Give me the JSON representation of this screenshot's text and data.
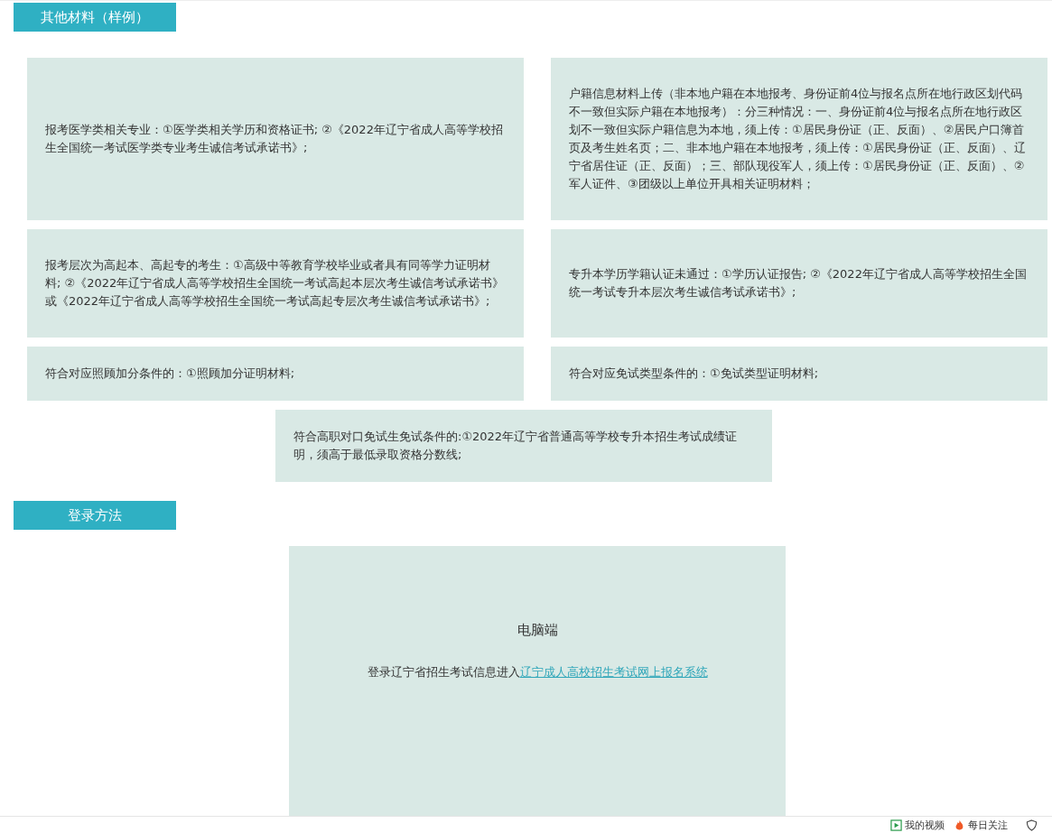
{
  "materials_section": {
    "title": "其他材料（样例）",
    "cards": [
      {
        "kind": "half",
        "text": "报考医学类相关专业：①医学类相关学历和资格证书; ②《2022年辽宁省成人高等学校招生全国统一考试医学类专业考生诚信考试承诺书》;"
      },
      {
        "kind": "half",
        "text": "户籍信息材料上传（非本地户籍在本地报考、身份证前4位与报名点所在地行政区划代码不一致但实际户籍在本地报考）：分三种情况：一、身份证前4位与报名点所在地行政区划不一致但实际户籍信息为本地，须上传：①居民身份证（正、反面）、②居民户口簿首页及考生姓名页；二、非本地户籍在本地报考，须上传：①居民身份证（正、反面）、辽宁省居住证（正、反面）；三、部队现役军人，须上传：①居民身份证（正、反面）、②军人证件、③团级以上单位开具相关证明材料；"
      },
      {
        "kind": "half",
        "text": "报考层次为高起本、高起专的考生：①高级中等教育学校毕业或者具有同等学力证明材料; ②《2022年辽宁省成人高等学校招生全国统一考试高起本层次考生诚信考试承诺书》或《2022年辽宁省成人高等学校招生全国统一考试高起专层次考生诚信考试承诺书》;"
      },
      {
        "kind": "half",
        "text": "专升本学历学籍认证未通过：①学历认证报告; ②《2022年辽宁省成人高等学校招生全国统一考试专升本层次考生诚信考试承诺书》;"
      },
      {
        "kind": "half",
        "text": "符合对应照顾加分条件的：①照顾加分证明材料;"
      },
      {
        "kind": "half",
        "text": "符合对应免试类型条件的：①免试类型证明材料;"
      },
      {
        "kind": "center",
        "text": "符合高职对口免试生免试条件的:①2022年辽宁省普通高等学校专升本招生考试成绩证明，须高于最低录取资格分数线;"
      }
    ]
  },
  "login_section": {
    "title": "登录方法",
    "card": {
      "heading": "电脑端",
      "text": "登录辽宁省招生考试信息进入",
      "link": "辽宁成人高校招生考试网上报名系统"
    }
  },
  "footer": {
    "items": [
      {
        "kind": "video",
        "label": "我的视频"
      },
      {
        "kind": "fire",
        "label": "每日关注"
      }
    ]
  }
}
